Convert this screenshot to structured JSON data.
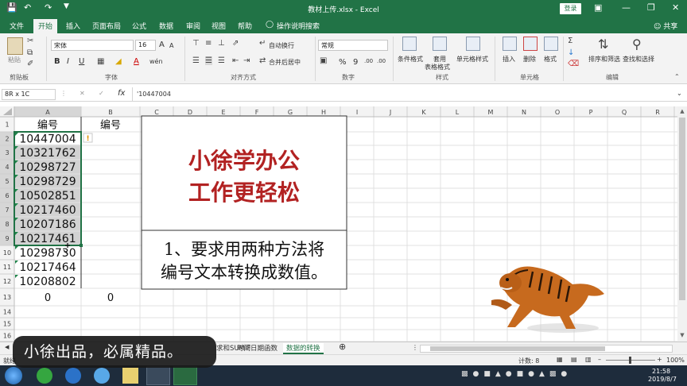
{
  "window": {
    "title": "教材上传.xlsx - Excel",
    "login_label": "登录"
  },
  "ribbon_tabs": [
    "文件",
    "开始",
    "插入",
    "页面布局",
    "公式",
    "数据",
    "审阅",
    "视图",
    "帮助",
    "操作说明搜索"
  ],
  "share_label": "共享",
  "ribbon": {
    "clipboard": {
      "paste_label": "粘贴",
      "group_label": "剪贴板"
    },
    "font": {
      "name": "宋体",
      "size": "16",
      "group_label": "字体",
      "increase_label": "A",
      "decrease_label": "A",
      "bold": "B",
      "italic": "I",
      "underline": "U",
      "font_color_label": "A",
      "phonetic_label": "wén"
    },
    "alignment": {
      "wrap_label": "自动换行",
      "merge_label": "合并后居中",
      "group_label": "对齐方式"
    },
    "number": {
      "format": "常规",
      "group_label": "数字",
      "percent_label": "%",
      "comma_label": "9",
      "increase_decimal": ".00",
      "decrease_decimal": ".00"
    },
    "styles": {
      "conditional_label": "条件格式",
      "table_label_1": "套用",
      "table_label_2": "表格格式",
      "cell_styles_label": "单元格样式",
      "group_label": "样式"
    },
    "cells": {
      "insert_label": "插入",
      "delete_label": "删除",
      "format_label": "格式",
      "group_label": "单元格"
    },
    "editing": {
      "sort_label": "排序和筛选",
      "find_label": "查找和选择",
      "group_label": "编辑"
    }
  },
  "formula_bar": {
    "name_box": "8R x 1C",
    "formula": "'10447004"
  },
  "grid": {
    "columns": [
      "A",
      "B",
      "C",
      "D",
      "E",
      "F",
      "G",
      "H",
      "I",
      "J",
      "K",
      "L",
      "M",
      "N",
      "O",
      "P",
      "Q",
      "R"
    ],
    "rows": [
      "1",
      "2",
      "3",
      "4",
      "5",
      "6",
      "7",
      "8",
      "9",
      "10",
      "11",
      "12",
      "13",
      "14",
      "15",
      "16"
    ],
    "col_a": [
      "编号",
      "10447004",
      "10321762",
      "10298727",
      "10298729",
      "10502851",
      "10217460",
      "10207186",
      "10217461",
      "10298730",
      "10217464",
      "10208802",
      "0"
    ],
    "col_b_header": "编号",
    "col_b_total": "0"
  },
  "textbox_top": {
    "line1": "小徐学办公",
    "line2": "工作更轻松"
  },
  "textbox_bottom": {
    "line1": "1、要求用两种方法将",
    "line2": "编号文本转换成数值。"
  },
  "sheets": {
    "tab1": "作",
    "tab2": "求和SUMIF",
    "tab3": "时间日期函数",
    "tab4": "数据的转换"
  },
  "status": {
    "ready": "就绪",
    "count": "计数: 8",
    "zoom": "100%"
  },
  "taskbar": {
    "time": "21:58",
    "date": "2019/8/7"
  },
  "caption": "小徐出品，必属精品。",
  "colors": {
    "excel_green": "#217346",
    "slogan_red": "#b22222"
  }
}
